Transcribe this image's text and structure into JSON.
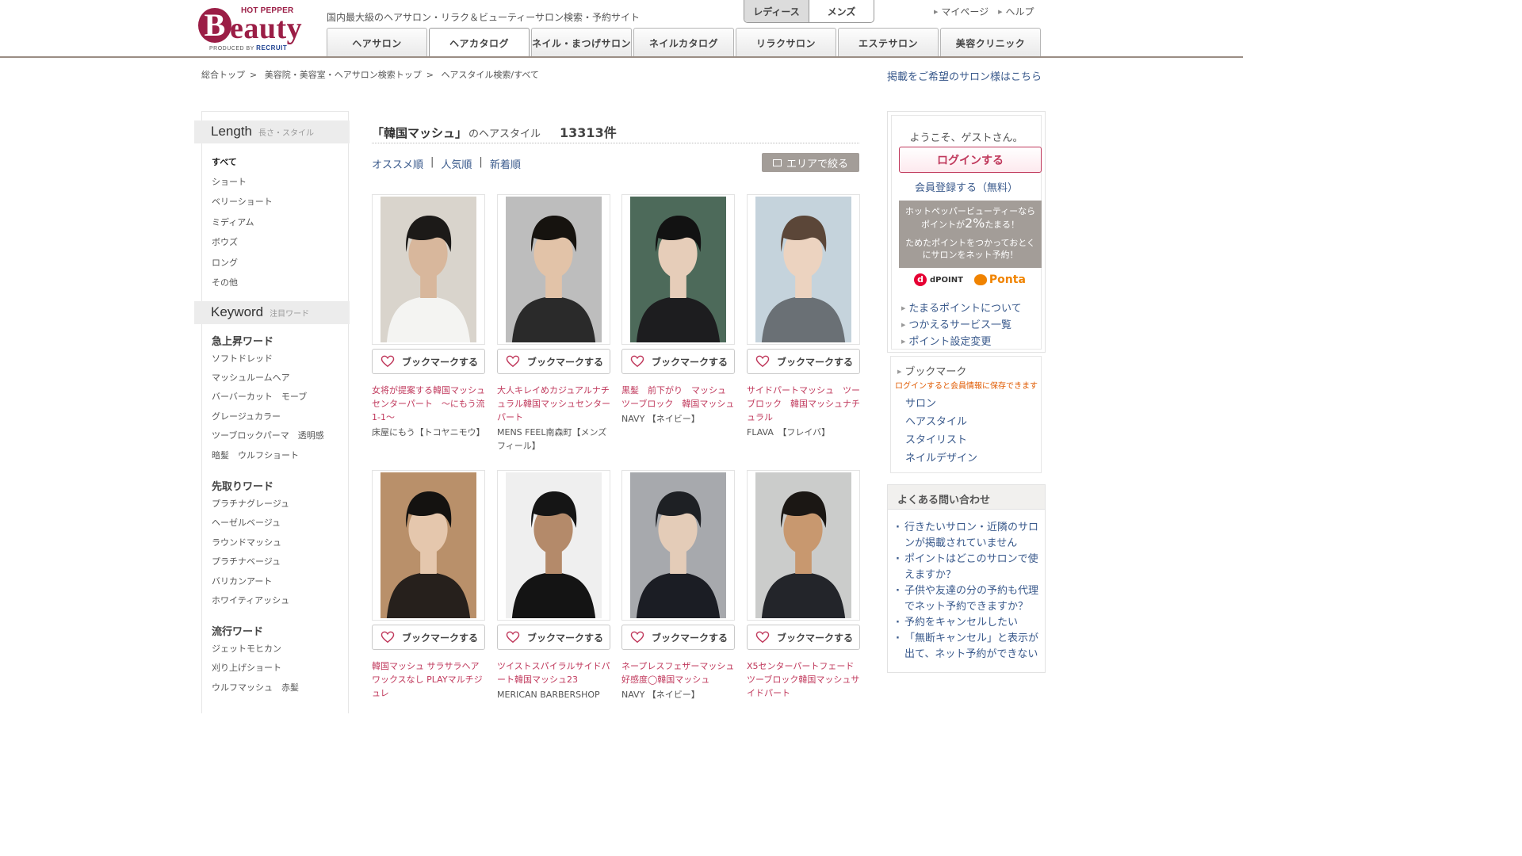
{
  "header": {
    "logo": {
      "hot_pepper": "HOT PEPPER",
      "b": "B",
      "eauty": "eauty",
      "produced_by": "PRODUCED BY",
      "recruit": "RECRUIT"
    },
    "tagline": "国内最大級のヘアサロン・リラク＆ビューティーサロン検索・予約サイト",
    "gender_tabs": [
      "レディース",
      "メンズ"
    ],
    "top_links": [
      "マイページ",
      "ヘルプ"
    ],
    "nav_tabs": [
      "ヘアサロン",
      "ヘアカタログ",
      "ネイル・まつげサロン",
      "ネイルカタログ",
      "リラクサロン",
      "エステサロン",
      "美容クリニック"
    ]
  },
  "breadcrumb": [
    "総合トップ",
    "美容院・美容室・ヘアサロン検索トップ",
    "ヘアスタイル検索/すべて"
  ],
  "salon_link": "掲載をご希望のサロン様はこちら",
  "sidebar": {
    "length": {
      "title": "Length",
      "sub": "長さ・スタイル",
      "items": [
        "すべて",
        "ショート",
        "ベリーショート",
        "ミディアム",
        "ボウズ",
        "ロング",
        "その他"
      ]
    },
    "keyword": {
      "title": "Keyword",
      "sub": "注目ワード",
      "groups": [
        {
          "title": "急上昇ワード",
          "items": [
            "ソフトドレッド",
            "マッシュルームヘア",
            "バーバーカット　モーブ",
            "グレージュカラー",
            "ツーブロックパーマ　透明感",
            "暗髪　ウルフショート"
          ]
        },
        {
          "title": "先取りワード",
          "items": [
            "プラチナグレージュ",
            "ヘーゼルベージュ",
            "ラウンドマッシュ",
            "プラチナベージュ",
            "バリカンアート",
            "ホワイティアッシュ"
          ]
        },
        {
          "title": "流行ワード",
          "items": [
            "ジェットモヒカン",
            "刈り上げショート",
            "ウルフマッシュ　赤髪"
          ]
        }
      ]
    }
  },
  "main": {
    "query": "「韓国マッシュ」",
    "query_suffix": "のヘアスタイル",
    "count": "13313件",
    "sort": [
      "オススメ順",
      "人気順",
      "新着順"
    ],
    "sort_sep": "|",
    "area_button": "エリアで絞る",
    "bookmark_label": "ブックマークする",
    "cards": [
      {
        "title": "女将が提案する韓国マッシュセンターパート　～にもう流1-1～",
        "salon": "床屋にもう【トコヤニモウ】",
        "bg": "#d9d4cc",
        "shirt": "#f4f4f2",
        "hair": "#1c1a18",
        "skin": "#d8b79c"
      },
      {
        "title": "大人キレイめカジュアルナチュラル韓国マッシュセンターパート",
        "salon": "MENS FEEL南森町【メンズフィール】",
        "bg": "#bdbdbd",
        "shirt": "#2a2a2a",
        "hair": "#16130f",
        "skin": "#e2c3a8"
      },
      {
        "title": "黒髪　前下がり　マッシュ　ツーブロック　韓国マッシュ",
        "salon": "NAVY 【ネイビー】",
        "bg": "#4d6a5a",
        "shirt": "#1d1d1f",
        "hair": "#121212",
        "skin": "#e6cdb9"
      },
      {
        "title": "サイドパートマッシュ　ツーブロック　韓国マッシュナチュラル",
        "salon": "FLAVA　【フレイバ】",
        "bg": "#c5d3dc",
        "shirt": "#6a7075",
        "hair": "#5b4638",
        "skin": "#ecd3c0"
      },
      {
        "title": "韓国マッシュ サラサラヘア ワックスなし PLAYマルチジュレ",
        "salon": "",
        "bg": "#b9906a",
        "shirt": "#26201c",
        "hair": "#141210",
        "skin": "#e5c7ad"
      },
      {
        "title": "ツイストスパイラルサイドパート韓国マッシュ23",
        "salon": "MERICAN BARBERSHOP",
        "bg": "#efefef",
        "shirt": "#141414",
        "hair": "#151515",
        "skin": "#b48a6a"
      },
      {
        "title": "ネープレスフェザーマッシュ好感度◯韓国マッシュ",
        "salon": "NAVY 【ネイビー】",
        "bg": "#a7a9ad",
        "shirt": "#1b1d24",
        "hair": "#1e2024",
        "skin": "#e4ccb8"
      },
      {
        "title": "X5センターパートフェードツーブロック韓国マッシュサイドパート",
        "salon": "",
        "bg": "#cbcccb",
        "shirt": "#23252a",
        "hair": "#1b1714",
        "skin": "#c8986f"
      }
    ]
  },
  "right": {
    "welcome": "ようこそ、ゲストさん。",
    "login": "ログインする",
    "register": "会員登録する（無料）",
    "points_line1": "ホットペッパービューティーなら",
    "points_line2a": "ポイントが",
    "points_big": "2%",
    "points_line2b": "たまる！",
    "points_line3": "ためたポイントをつかっておとく",
    "points_line4": "にサロンをネット予約！",
    "dpoint": "dPOINT",
    "dpoint_d": "d",
    "ponta": "Ponta",
    "point_links": [
      "たまるポイントについて",
      "つかえるサービス一覧",
      "ポイント設定変更"
    ],
    "bookmark_title": "ブックマーク",
    "bookmark_note": "ログインすると会員情報に保存できます",
    "bookmark_links": [
      "サロン",
      "ヘアスタイル",
      "スタイリスト",
      "ネイルデザイン"
    ],
    "faq_title": "よくある問い合わせ",
    "faq": [
      "行きたいサロン・近隣のサロンが掲載されていません",
      "ポイントはどこのサロンで使えますか？",
      "子供や友達の分の予約も代理でネット予約できますか？",
      "予約をキャンセルしたい",
      "「無断キャンセル」と表示が出て、ネット予約ができない"
    ]
  },
  "colors": {
    "brand": "#9b1e46",
    "link": "#3a5a8c",
    "accent_pink": "#c0395c"
  }
}
